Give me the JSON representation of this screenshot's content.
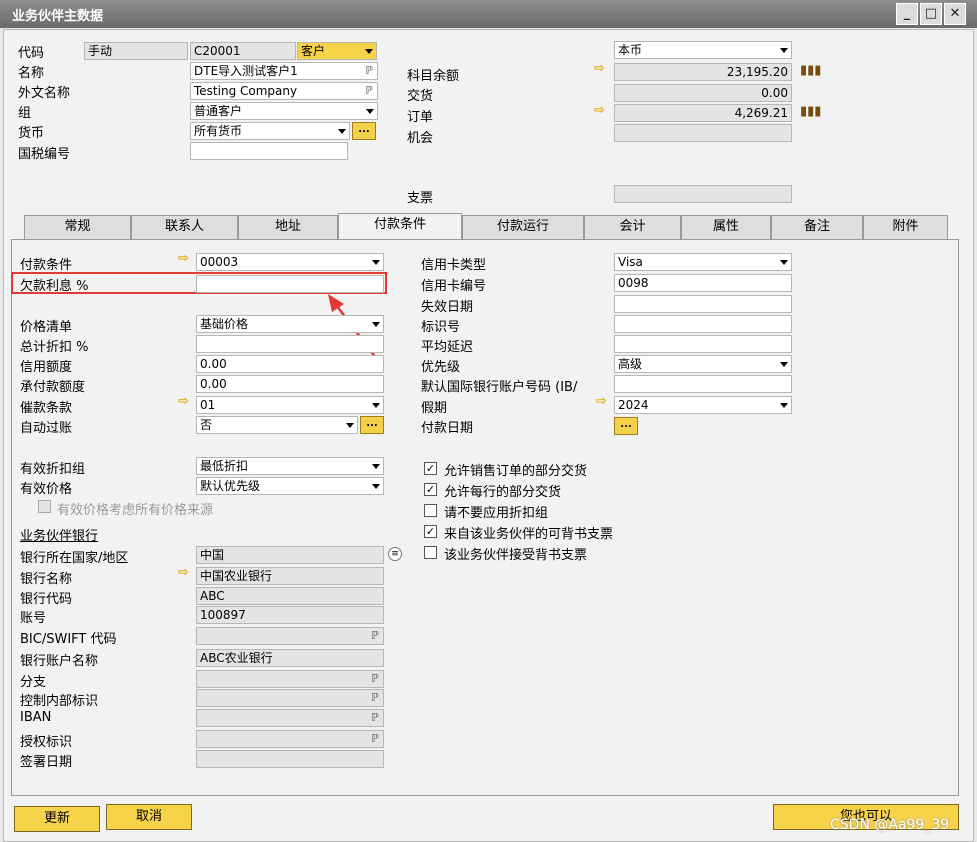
{
  "window": {
    "title": "业务伙伴主数据",
    "min": "_",
    "max": "□",
    "close": "✕"
  },
  "header": {
    "code_label": "代码",
    "code_mode": "手动",
    "code_value": "C20001",
    "code_type": "客户",
    "name_label": "名称",
    "name_value": "DTE导入测试客户1",
    "foreign_name_label": "外文名称",
    "foreign_name_value": "Testing Company",
    "group_label": "组",
    "group_value": "普通客户",
    "currency_label": "货币",
    "currency_value": "所有货币",
    "tax_label": "国税编号",
    "tax_value": "",
    "currency_scope": "本币",
    "balance_label": "科目余额",
    "balance_value": "23,195.20",
    "delivery_label": "交货",
    "delivery_value": "0.00",
    "order_label": "订单",
    "order_value": "4,269.21",
    "opportunity_label": "机会",
    "opportunity_value": "",
    "cheque_label": "支票",
    "cheque_value": ""
  },
  "tabs": [
    "常规",
    "联系人",
    "地址",
    "付款条件",
    "付款运行",
    "会计",
    "属性",
    "备注",
    "附件"
  ],
  "left": {
    "pay_terms_label": "付款条件",
    "pay_terms_value": "00003",
    "interest_label": "欠款利息 %",
    "interest_value": "",
    "price_list_label": "价格清单",
    "price_list_value": "基础价格",
    "total_discount_label": "总计折扣 %",
    "total_discount_value": "",
    "credit_limit_label": "信用额度",
    "credit_limit_value": "0.00",
    "commit_limit_label": "承付款额度",
    "commit_limit_value": "0.00",
    "dunning_label": "催款条款",
    "dunning_value": "01",
    "auto_post_label": "自动过账",
    "auto_post_value": "否",
    "eff_disc_group_label": "有效折扣组",
    "eff_disc_group_value": "最低折扣",
    "eff_price_label": "有效价格",
    "eff_price_value": "默认优先级",
    "eff_price_all_label": "有效价格考虑所有价格来源",
    "bank_section": "业务伙伴银行",
    "bank_country_label": "银行所在国家/地区",
    "bank_country_value": "中国",
    "bank_name_label": "银行名称",
    "bank_name_value": "中国农业银行",
    "bank_code_label": "银行代码",
    "bank_code_value": "ABC",
    "account_label": "账号",
    "account_value": "100897",
    "bic_label": "BIC/SWIFT 代码",
    "bic_value": "",
    "acct_name_label": "银行账户名称",
    "acct_name_value": "ABC农业银行",
    "branch_label": "分支",
    "branch_value": "",
    "ctrl_key_label": "控制内部标识",
    "ctrl_key_value": "",
    "iban_label": "IBAN",
    "iban_value": "",
    "mandate_label": "授权标识",
    "mandate_value": "",
    "sign_date_label": "签署日期",
    "sign_date_value": ""
  },
  "right": {
    "cc_type_label": "信用卡类型",
    "cc_type_value": "Visa",
    "cc_no_label": "信用卡编号",
    "cc_no_value": "0098",
    "expiry_label": "失效日期",
    "expiry_value": "",
    "id_label": "标识号",
    "id_value": "",
    "avg_delay_label": "平均延迟",
    "avg_delay_value": "",
    "priority_label": "优先级",
    "priority_value": "高级",
    "iban_default_label": "默认国际银行账户号码 (IB/",
    "iban_default_value": "",
    "holiday_label": "假期",
    "holiday_value": "2024",
    "pay_date_label": "付款日期",
    "checks": [
      {
        "label": "允许销售订单的部分交货",
        "checked": true
      },
      {
        "label": "允许每行的部分交货",
        "checked": true
      },
      {
        "label": "请不要应用折扣组",
        "checked": false
      },
      {
        "label": "来自该业务伙伴的可背书支票",
        "checked": true
      },
      {
        "label": "该业务伙伴接受背书支票",
        "checked": false
      }
    ]
  },
  "footer": {
    "update": "更新",
    "cancel": "取消",
    "also": "您也可以",
    "watermark": "CSDN @Aa99_39"
  },
  "glyphs": {
    "check": "✓",
    "pin": "ℙ",
    "arrow": "⇨",
    "ellipsis": "...",
    "bars": "▮▮▮"
  },
  "colors": {
    "accent": "#f7d34a",
    "highlight": "#e53935"
  }
}
